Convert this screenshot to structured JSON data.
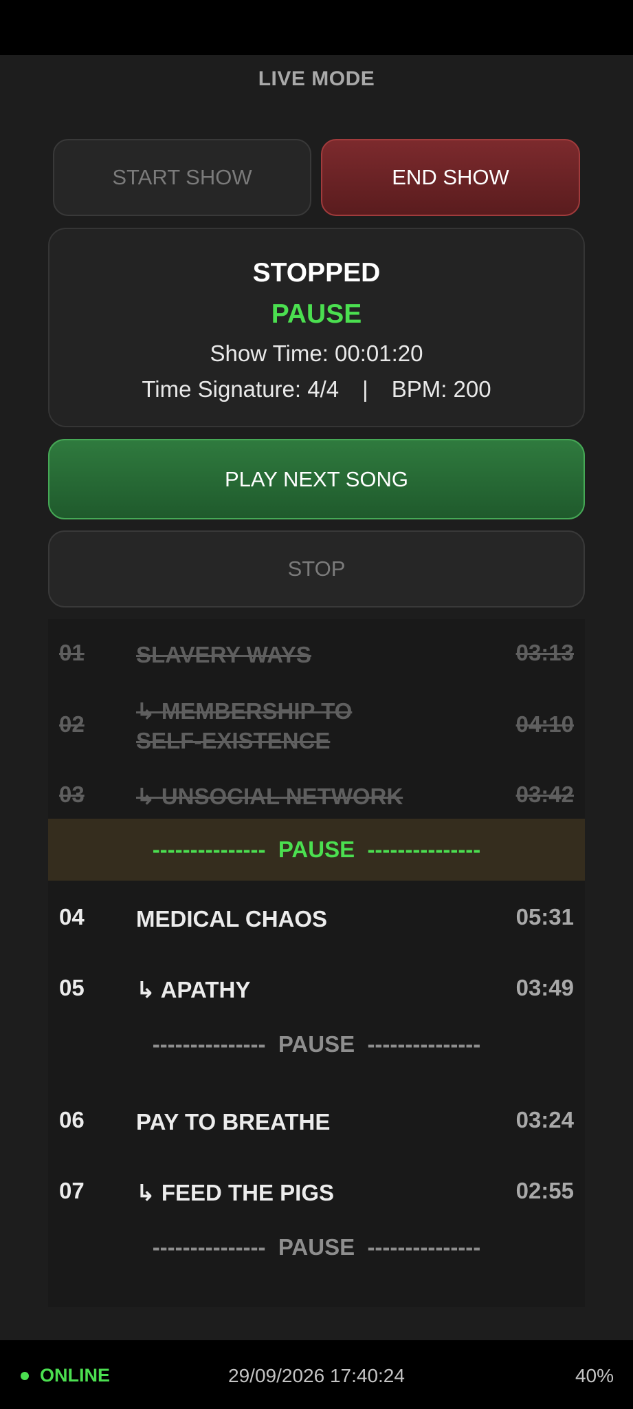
{
  "header": {
    "title": "LIVE MODE"
  },
  "controls": {
    "start_label": "START SHOW",
    "end_label": "END SHOW",
    "play_next_label": "PLAY NEXT SONG",
    "stop_label": "STOP"
  },
  "status": {
    "state": "STOPPED",
    "mode": "PAUSE",
    "show_time": "Show Time: 00:01:20",
    "time_signature": "Time Signature: 4/4",
    "separator": "|",
    "bpm": "BPM: 200"
  },
  "setlist": {
    "songs": [
      {
        "num": "01",
        "name": "SLAVERY WAYS",
        "duration": "03:13"
      },
      {
        "num": "02",
        "name": "↳ MEMBERSHIP TO",
        "name_line2": "SELF-EXISTENCE",
        "duration": "04:10"
      },
      {
        "num": "03",
        "name": "↳ UNSOCIAL NETWORK",
        "duration": "03:42"
      },
      {
        "num": "04",
        "name": "MEDICAL CHAOS",
        "duration": "05:31"
      },
      {
        "num": "05",
        "name": "↳ APATHY",
        "duration": "03:49"
      },
      {
        "num": "06",
        "name": "PAY TO BREATHE",
        "duration": "03:24"
      },
      {
        "num": "07",
        "name": "↳ FEED THE PIGS",
        "duration": "02:55"
      }
    ],
    "pause_label": "---------------  PAUSE  ---------------"
  },
  "footer": {
    "connection": "ONLINE",
    "datetime": "29/09/2026 17:40:24",
    "battery": "40%"
  },
  "colors": {
    "accent_green": "#4bdf50",
    "end_red": "#7c2a2d",
    "play_green": "#2f7a3e",
    "pause_highlight": "#352d1e"
  }
}
